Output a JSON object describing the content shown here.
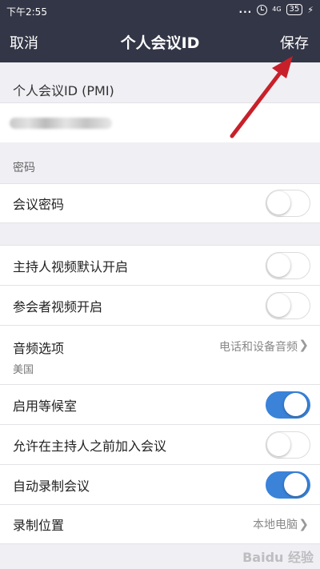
{
  "statusbar": {
    "time": "下午2:55",
    "dots": "...",
    "signal": "4G",
    "battery": "35",
    "bolt": "⚡"
  },
  "nav": {
    "cancel": "取消",
    "title": "个人会议ID",
    "save": "保存"
  },
  "pmi_section": {
    "header": "个人会议ID (PMI)"
  },
  "password_section": {
    "header": "密码",
    "meeting_password": {
      "label": "会议密码",
      "on": false
    }
  },
  "settings": {
    "host_video": {
      "label": "主持人视频默认开启",
      "on": false
    },
    "participant_video": {
      "label": "参会者视频开启",
      "on": false
    },
    "audio": {
      "label": "音频选项",
      "value": "电话和设备音频",
      "sub": "美国"
    },
    "waiting_room": {
      "label": "启用等候室",
      "on": true
    },
    "join_before_host": {
      "label": "允许在主持人之前加入会议",
      "on": false
    },
    "auto_record": {
      "label": "自动录制会议",
      "on": true
    },
    "record_location": {
      "label": "录制位置",
      "value": "本地电脑"
    }
  },
  "watermark": "Baidu 经验",
  "colors": {
    "navbar": "#333646",
    "toggle_on": "#3a83d9",
    "annotation_arrow": "#c8202a"
  }
}
